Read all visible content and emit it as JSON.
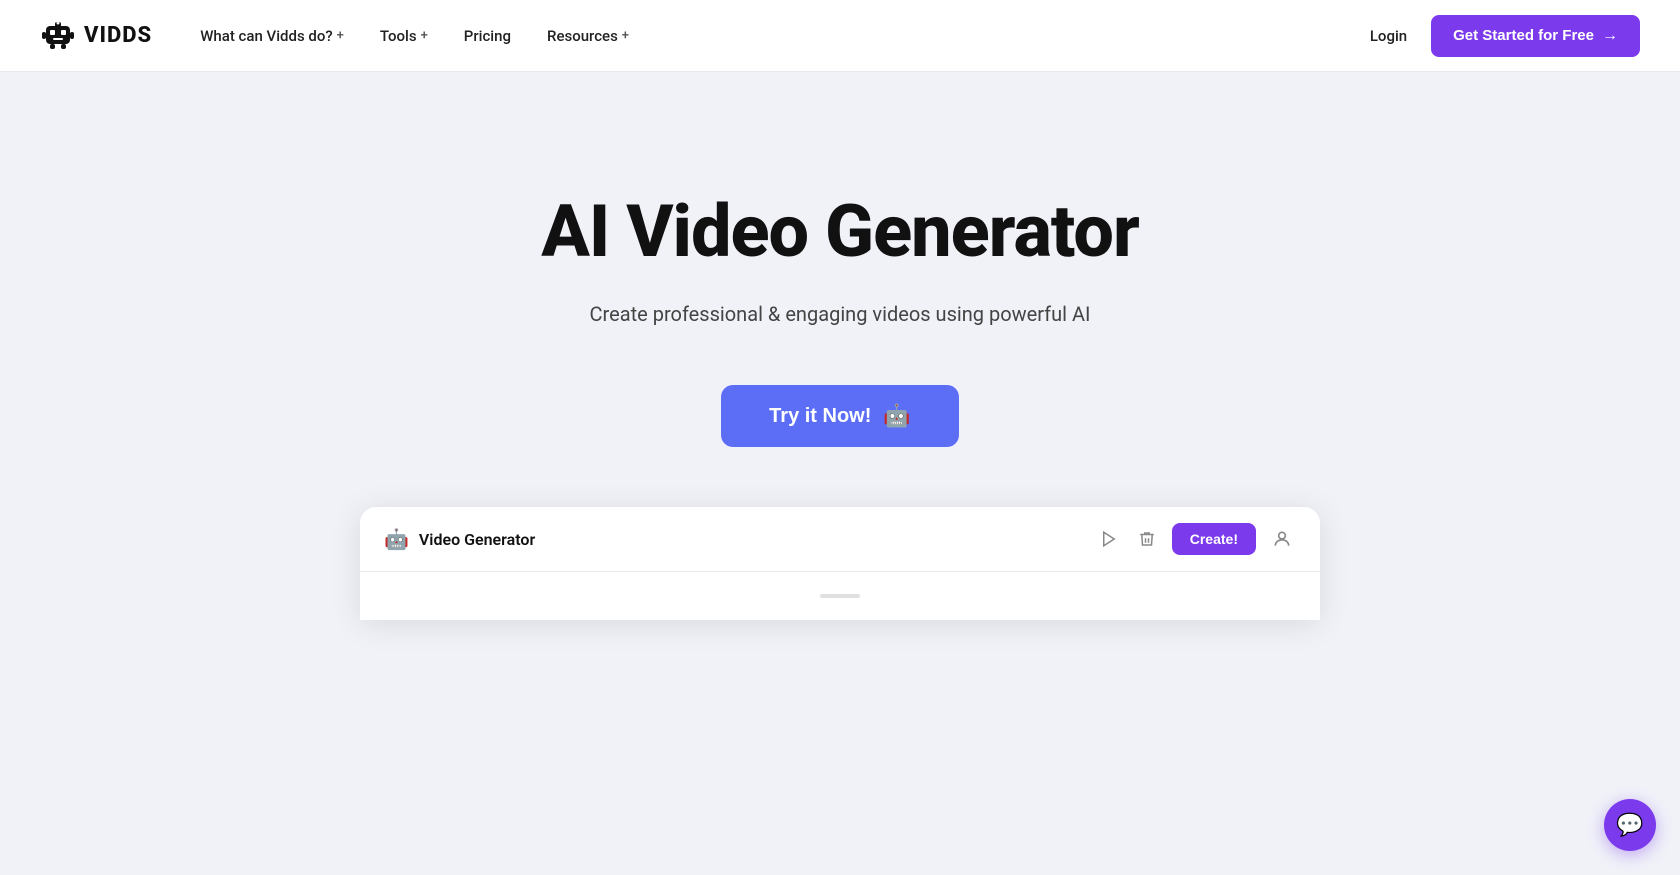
{
  "brand": {
    "logo_text": "VIDDS",
    "logo_icon_alt": "vidds-logo"
  },
  "navbar": {
    "links": [
      {
        "label": "What can Vidds do?",
        "has_plus": true
      },
      {
        "label": "Tools",
        "has_plus": true
      },
      {
        "label": "Pricing",
        "has_plus": false
      },
      {
        "label": "Resources",
        "has_plus": true
      }
    ],
    "login_label": "Login",
    "cta_label": "Get Started for Free",
    "cta_arrow": "→"
  },
  "hero": {
    "title": "AI Video Generator",
    "subtitle": "Create professional & engaging videos using powerful AI",
    "cta_label": "Try it Now!"
  },
  "panel": {
    "title": "Video Generator",
    "create_label": "Create!"
  },
  "colors": {
    "purple": "#7c3aed",
    "blue_button": "#5b6ef5",
    "bg": "#f0f2f8",
    "white": "#ffffff",
    "text_dark": "#111111",
    "text_mid": "#444444"
  }
}
